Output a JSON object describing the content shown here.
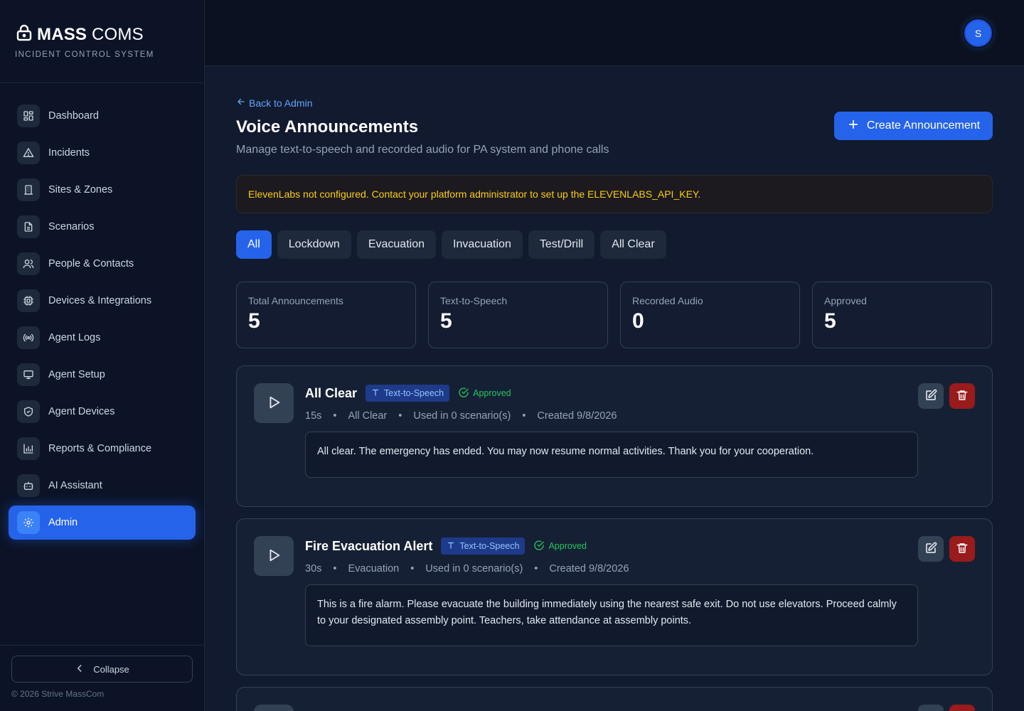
{
  "brand": {
    "name_bold": "MASS",
    "name_light": "COMS",
    "subtitle": "INCIDENT CONTROL SYSTEM"
  },
  "sidebar": {
    "items": [
      {
        "label": "Dashboard",
        "icon": "grid-icon"
      },
      {
        "label": "Incidents",
        "icon": "alert-triangle-icon"
      },
      {
        "label": "Sites & Zones",
        "icon": "building-icon"
      },
      {
        "label": "Scenarios",
        "icon": "file-text-icon"
      },
      {
        "label": "People & Contacts",
        "icon": "users-icon"
      },
      {
        "label": "Devices & Integrations",
        "icon": "cpu-icon"
      },
      {
        "label": "Agent Logs",
        "icon": "radio-icon"
      },
      {
        "label": "Agent Setup",
        "icon": "monitor-icon"
      },
      {
        "label": "Agent Devices",
        "icon": "shield-icon"
      },
      {
        "label": "Reports & Compliance",
        "icon": "bar-chart-icon"
      },
      {
        "label": "AI Assistant",
        "icon": "bot-icon"
      },
      {
        "label": "Admin",
        "icon": "gear-icon",
        "active": true
      }
    ],
    "collapse_label": "Collapse",
    "copyright": "© 2026 Strive MassCom"
  },
  "topbar": {
    "avatar_initial": "S"
  },
  "page": {
    "back_label": "Back to Admin",
    "title": "Voice Announcements",
    "subtitle": "Manage text-to-speech and recorded audio for PA system and phone calls",
    "create_label": "Create Announcement",
    "warning": "ElevenLabs not configured. Contact your platform administrator to set up the ELEVENLABS_API_KEY."
  },
  "filters": [
    "All",
    "Lockdown",
    "Evacuation",
    "Invacuation",
    "Test/Drill",
    "All Clear"
  ],
  "stats": [
    {
      "label": "Total Announcements",
      "value": "5"
    },
    {
      "label": "Text-to-Speech",
      "value": "5"
    },
    {
      "label": "Recorded Audio",
      "value": "0"
    },
    {
      "label": "Approved",
      "value": "5"
    }
  ],
  "announcements": [
    {
      "title": "All Clear",
      "type_badge": "Text-to-Speech",
      "status_badge": "Approved",
      "duration": "15s",
      "category": "All Clear",
      "usage": "Used in 0 scenario(s)",
      "created": "Created 9/8/2026",
      "script": "All clear. The emergency has ended. You may now resume normal activities. Thank you for your cooperation."
    },
    {
      "title": "Fire Evacuation Alert",
      "type_badge": "Text-to-Speech",
      "status_badge": "Approved",
      "duration": "30s",
      "category": "Evacuation",
      "usage": "Used in 0 scenario(s)",
      "created": "Created 9/8/2026",
      "script": "This is a fire alarm. Please evacuate the building immediately using the nearest safe exit. Do not use elevators. Proceed calmly to your designated assembly point. Teachers, take attendance at assembly points."
    }
  ],
  "colors": {
    "accent": "#2563eb",
    "warning": "#facc15",
    "success": "#22c55e",
    "danger": "#991b1b"
  }
}
